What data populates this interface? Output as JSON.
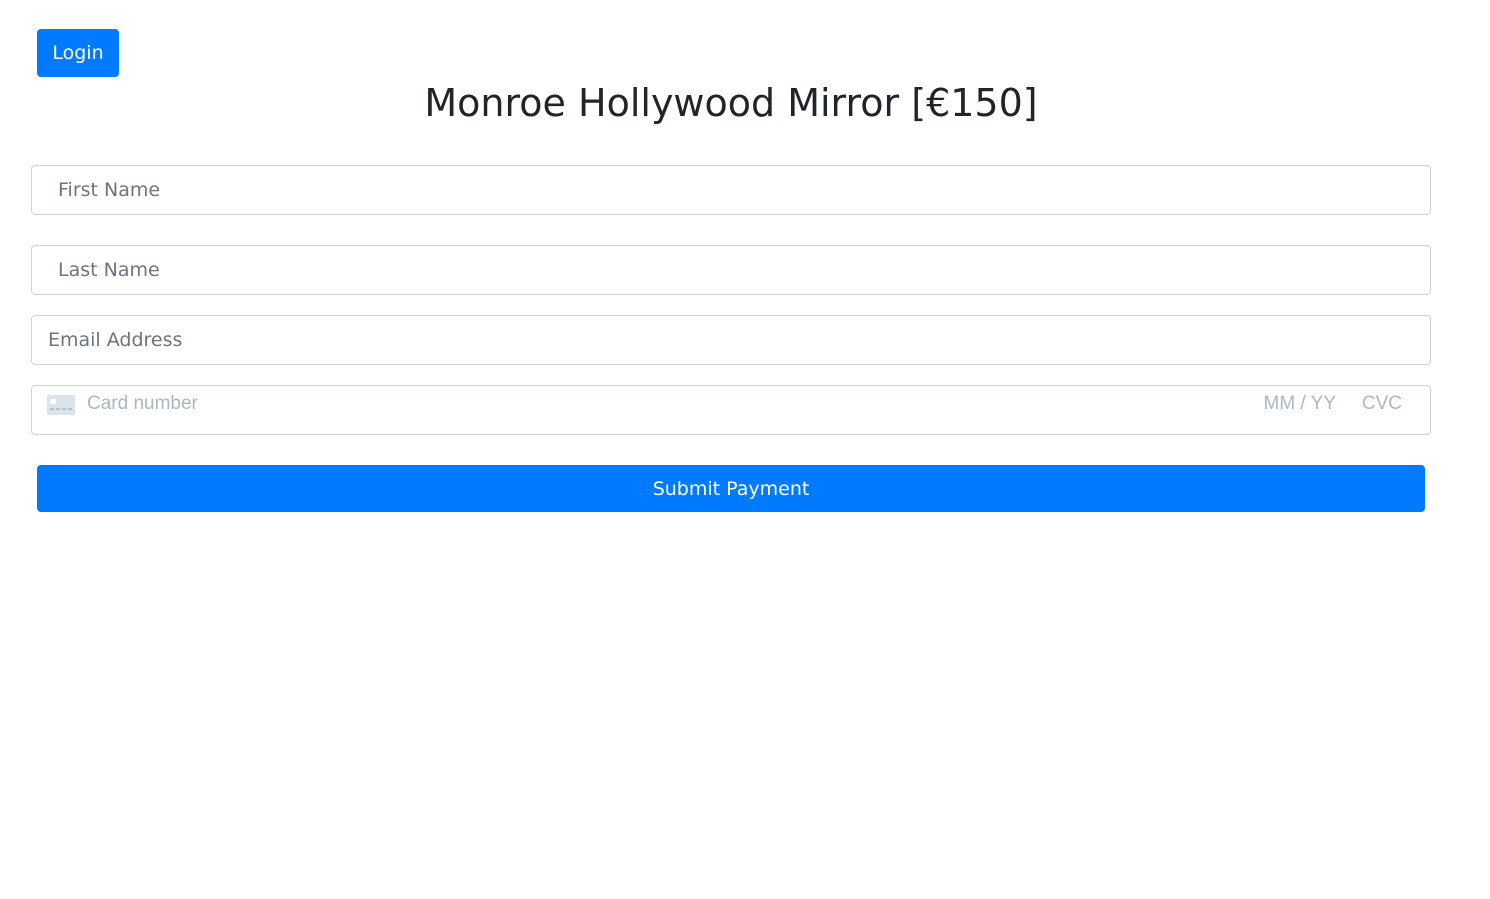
{
  "header": {
    "login_label": "Login",
    "title": "Monroe Hollywood Mirror [€150]"
  },
  "form": {
    "first_name": {
      "value": "",
      "placeholder": "First Name"
    },
    "last_name": {
      "value": "",
      "placeholder": "Last Name"
    },
    "email": {
      "value": "",
      "placeholder": "Email Address"
    },
    "card": {
      "icon": "credit-card-icon",
      "number_placeholder": "Card number",
      "expiry_placeholder": "MM / YY",
      "cvc_placeholder": "CVC"
    },
    "submit_label": "Submit Payment"
  },
  "colors": {
    "primary": "#007bff",
    "border": "#ced4da",
    "placeholder": "#6c757d",
    "card_placeholder": "#aab7c4",
    "text": "#212529"
  }
}
